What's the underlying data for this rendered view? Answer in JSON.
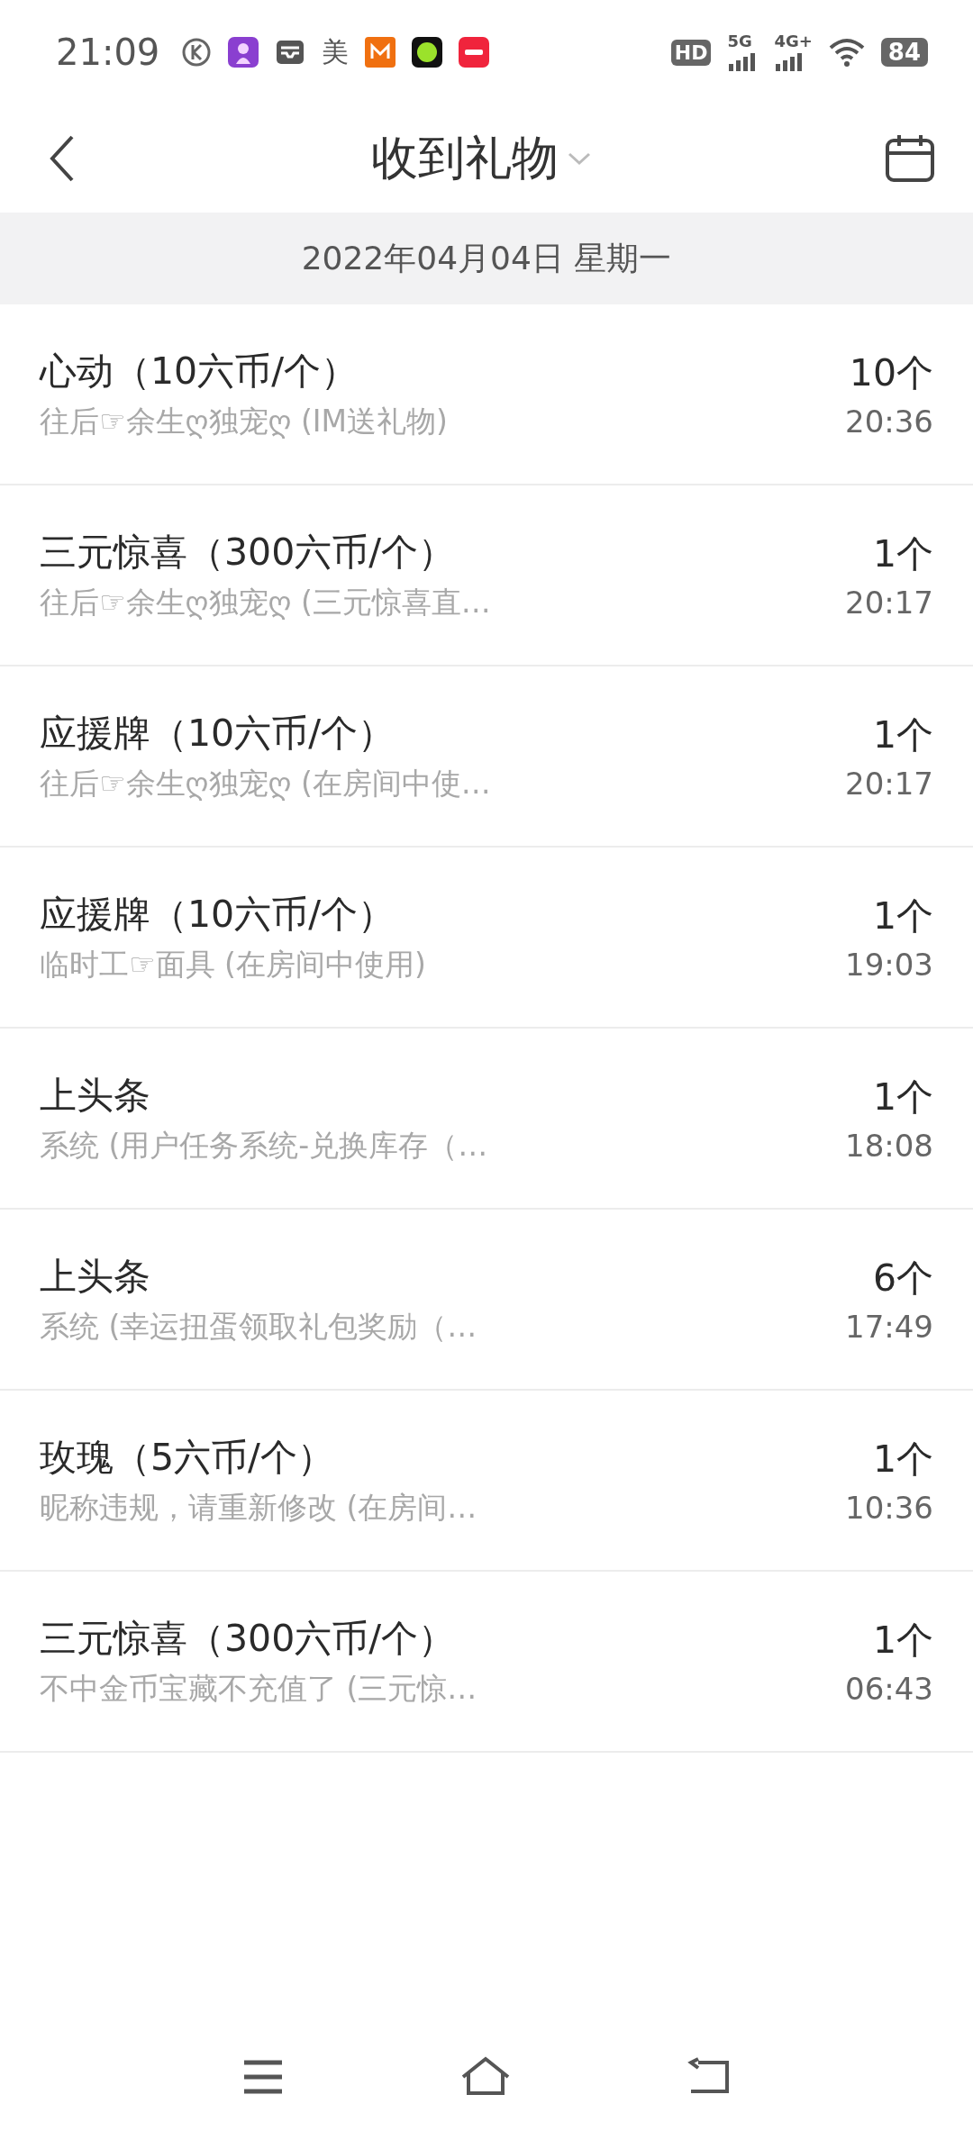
{
  "status_bar": {
    "time": "21:09",
    "notification_text": "美",
    "hd": "HD",
    "net_5g": "5G",
    "net_4g": "4G+",
    "battery": "84"
  },
  "header": {
    "title": "收到礼物"
  },
  "date_bar": "2022年04月04日 星期一",
  "gifts": [
    {
      "name": "心动（10六币/个）",
      "detail": "往后☞余生ღ独宠ღ (IM送礼物)",
      "count": "10个",
      "time": "20:36"
    },
    {
      "name": "三元惊喜（300六币/个）",
      "detail": "往后☞余生ღ独宠ღ (三元惊喜直…",
      "count": "1个",
      "time": "20:17"
    },
    {
      "name": "应援牌（10六币/个）",
      "detail": "往后☞余生ღ独宠ღ (在房间中使…",
      "count": "1个",
      "time": "20:17"
    },
    {
      "name": "应援牌（10六币/个）",
      "detail": "临时工☞面具 (在房间中使用)",
      "count": "1个",
      "time": "19:03"
    },
    {
      "name": "上头条",
      "detail": "系统 (用户任务系统-兑换库存（…",
      "count": "1个",
      "time": "18:08"
    },
    {
      "name": "上头条",
      "detail": "系统 (幸运扭蛋领取礼包奖励（…",
      "count": "6个",
      "time": "17:49"
    },
    {
      "name": "玫瑰（5六币/个）",
      "detail": "昵称违规，请重新修改 (在房间…",
      "count": "1个",
      "time": "10:36"
    },
    {
      "name": "三元惊喜（300六币/个）",
      "detail": "不中金币宝藏不充值了 (三元惊…",
      "count": "1个",
      "time": "06:43"
    }
  ]
}
